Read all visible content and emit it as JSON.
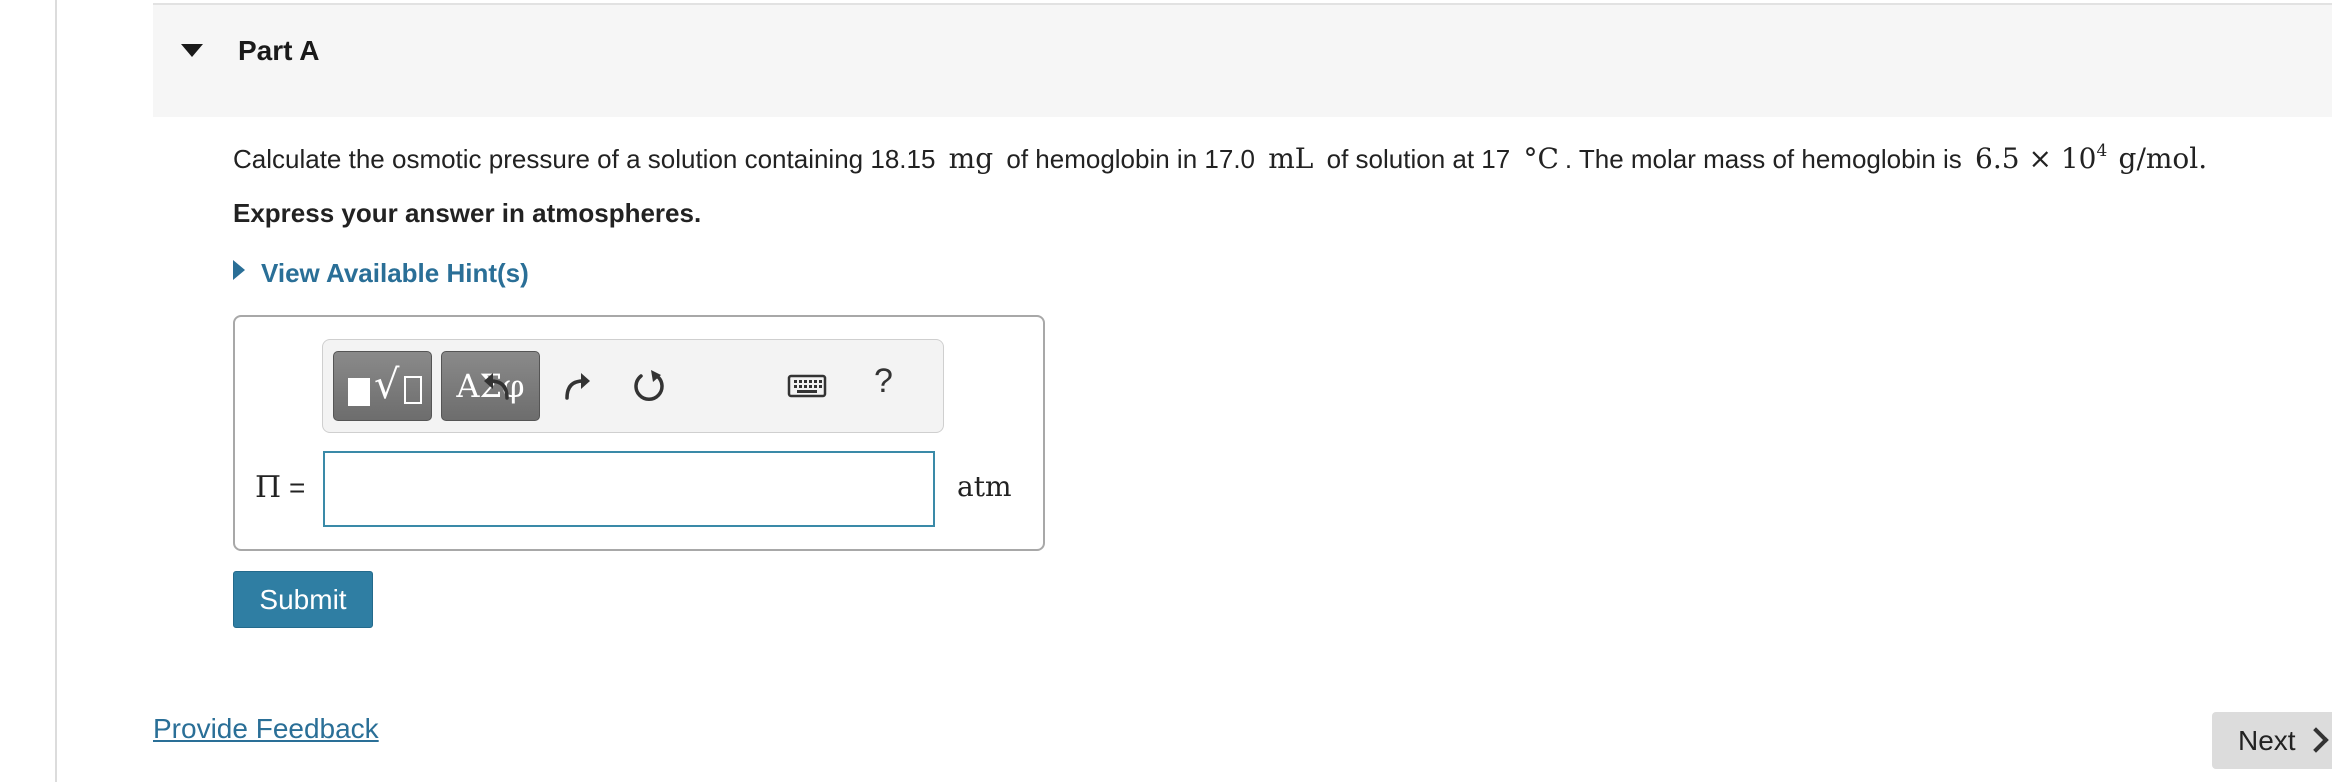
{
  "part": {
    "title": "Part A"
  },
  "question": {
    "t1": "Calculate the osmotic pressure of a solution containing 18.15",
    "m1": "mg",
    "t2": "of hemoglobin in 17.0",
    "m2": "mL",
    "t3": "of solution at 17",
    "m3": "°C",
    "t4": ". The molar mass of hemoglobin is",
    "m4a": "6.5 × 10",
    "m4exp": "4",
    "m4b": "g/mol",
    "t5": "."
  },
  "instruction": "Express your answer in atmospheres.",
  "hint": {
    "label": "View Available Hint(s)"
  },
  "toolbar": {
    "symbols_label": "ΑΣφ",
    "help_label": "?",
    "icons": [
      "templates-icon",
      "symbols-icon",
      "undo-icon",
      "redo-icon",
      "reset-icon",
      "keyboard-icon",
      "help-icon"
    ]
  },
  "answer": {
    "variable": "Π",
    "equals": "=",
    "value": "",
    "placeholder": "",
    "unit": "atm"
  },
  "submit_label": "Submit",
  "feedback_label": "Provide Feedback",
  "next_label": "Next",
  "colors": {
    "link": "#2a6f97",
    "submit": "#2f7ea3",
    "input_border": "#3a8aa8"
  }
}
